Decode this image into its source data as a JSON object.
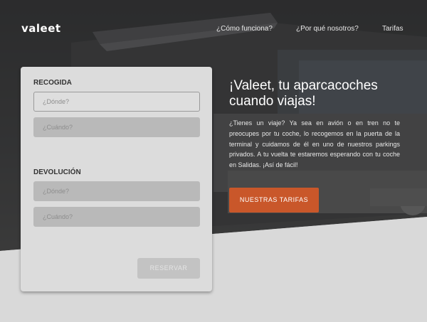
{
  "brand": {
    "logo_text": "valeet"
  },
  "nav": {
    "links": [
      {
        "label": "¿Cómo funciona?"
      },
      {
        "label": "¿Por qué nosotros?"
      },
      {
        "label": "Tarifas"
      }
    ]
  },
  "booking": {
    "pickup": {
      "title": "RECOGIDA",
      "where_placeholder": "¿Dónde?",
      "when_placeholder": "¿Cuándo?"
    },
    "return": {
      "title": "DEVOLUCIÓN",
      "where_placeholder": "¿Dónde?",
      "when_placeholder": "¿Cuándo?"
    },
    "submit_label": "RESERVAR"
  },
  "hero": {
    "headline": "¡Valeet, tu aparcacoches cuando viajas!",
    "description": "¿Tienes un viaje? Ya sea en avión o en tren no te preocupes por tu coche, lo recogemos en la puerta de la terminal y cuidamos de él en uno de nuestros parkings privados. A tu vuelta te estaremos esperando con tu coche en Salidas. ¡Así de fácil!",
    "cta_label": "NUESTRAS TARIFAS"
  },
  "colors": {
    "accent": "#c9572a",
    "overlay": "#2e2e2e",
    "background": "#d9d9d9",
    "panel": "#dcdcdc"
  }
}
